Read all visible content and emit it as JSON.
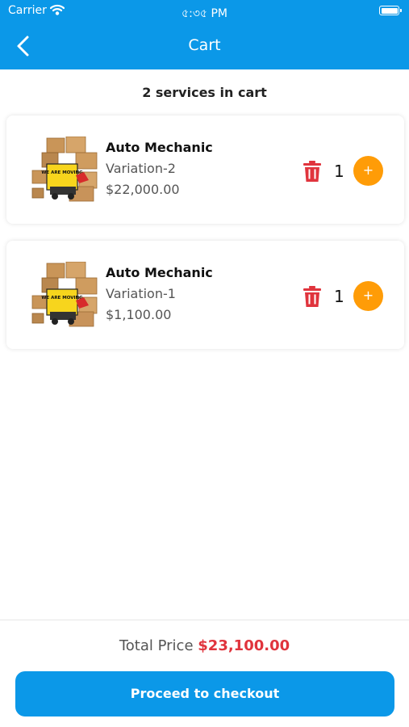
{
  "status_bar": {
    "carrier": "Carrier",
    "time": "৫:৩৫ PM",
    "wifi_icon": "wifi-icon",
    "battery_icon": "battery-icon"
  },
  "nav": {
    "title": "Cart",
    "back_icon": "chevron-left-icon"
  },
  "summary": "2 services in cart",
  "cart": {
    "items": [
      {
        "name": "Auto Mechanic",
        "variation": "Variation-2",
        "price": "$22,000.00",
        "quantity": "1",
        "image_text": "WE ARE MOVING"
      },
      {
        "name": "Auto Mechanic",
        "variation": "Variation-1",
        "price": "$1,100.00",
        "quantity": "1",
        "image_text": "WE ARE MOVING"
      }
    ],
    "delete_icon": "trash-icon",
    "increment_label": "+"
  },
  "footer": {
    "total_label": "Total Price",
    "total_amount": "$23,100.00",
    "checkout_label": "Proceed to checkout"
  },
  "colors": {
    "primary": "#0b98e8",
    "accent": "#ff9c07",
    "danger": "#e0343d"
  }
}
